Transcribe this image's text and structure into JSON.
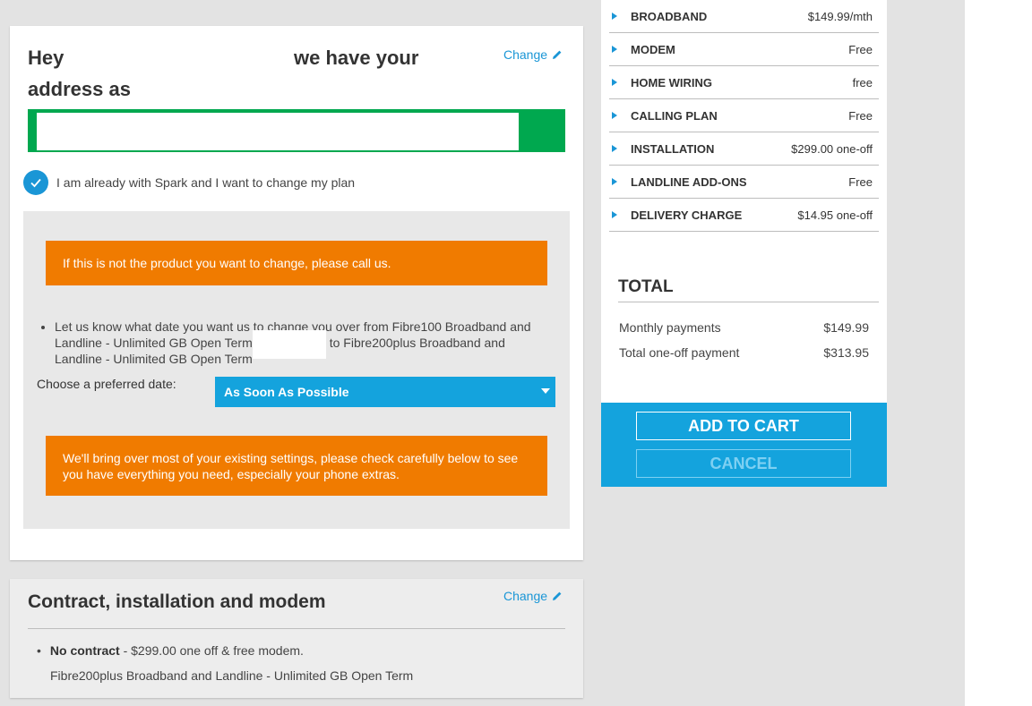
{
  "address_card": {
    "greeting": "Hey",
    "greeting_rest": "we have your",
    "greeting_line2": "address as",
    "change_label": "Change",
    "checkbox_label": "I am already with Spark and I want to change my plan",
    "notice_1": "If this is not the product you want to change, please call us.",
    "bullet_part1": "Let us know what date you want us to change you over from Fibre100 Broadband and Landline - Unlimited GB Open Term",
    "bullet_part2": "to Fibre200plus Broadband and Landline - Unlimited GB Open Term",
    "date_label": "Choose a preferred date:",
    "date_value": "As Soon As Possible",
    "notice_2": "We'll bring over most of your existing settings, please check carefully below to see you have everything you need, especially your phone extras."
  },
  "contract_card": {
    "title": "Contract, installation and modem",
    "change_label": "Change",
    "bullet_bold": "No contract",
    "bullet_rest": "- $299.00 one off & free modem.",
    "plan": "Fibre200plus Broadband and Landline - Unlimited GB Open Term"
  },
  "summary": {
    "items": [
      {
        "label": "BROADBAND",
        "value": "$149.99/mth"
      },
      {
        "label": "MODEM",
        "value": "Free"
      },
      {
        "label": "HOME WIRING",
        "value": "free"
      },
      {
        "label": "CALLING PLAN",
        "value": "Free"
      },
      {
        "label": "INSTALLATION",
        "value": "$299.00 one-off"
      },
      {
        "label": "LANDLINE ADD-ONS",
        "value": "Free"
      },
      {
        "label": "DELIVERY CHARGE",
        "value": "$14.95 one-off"
      }
    ],
    "total_title": "TOTAL",
    "monthly_label": "Monthly payments",
    "monthly_value": "$149.99",
    "oneoff_label": "Total one-off payment",
    "oneoff_value": "$313.95"
  },
  "actions": {
    "add_to_cart": "ADD TO CART",
    "cancel": "CANCEL"
  },
  "colors": {
    "accent_blue": "#14a3dd",
    "orange": "#f07b00",
    "green": "#00a84f"
  }
}
